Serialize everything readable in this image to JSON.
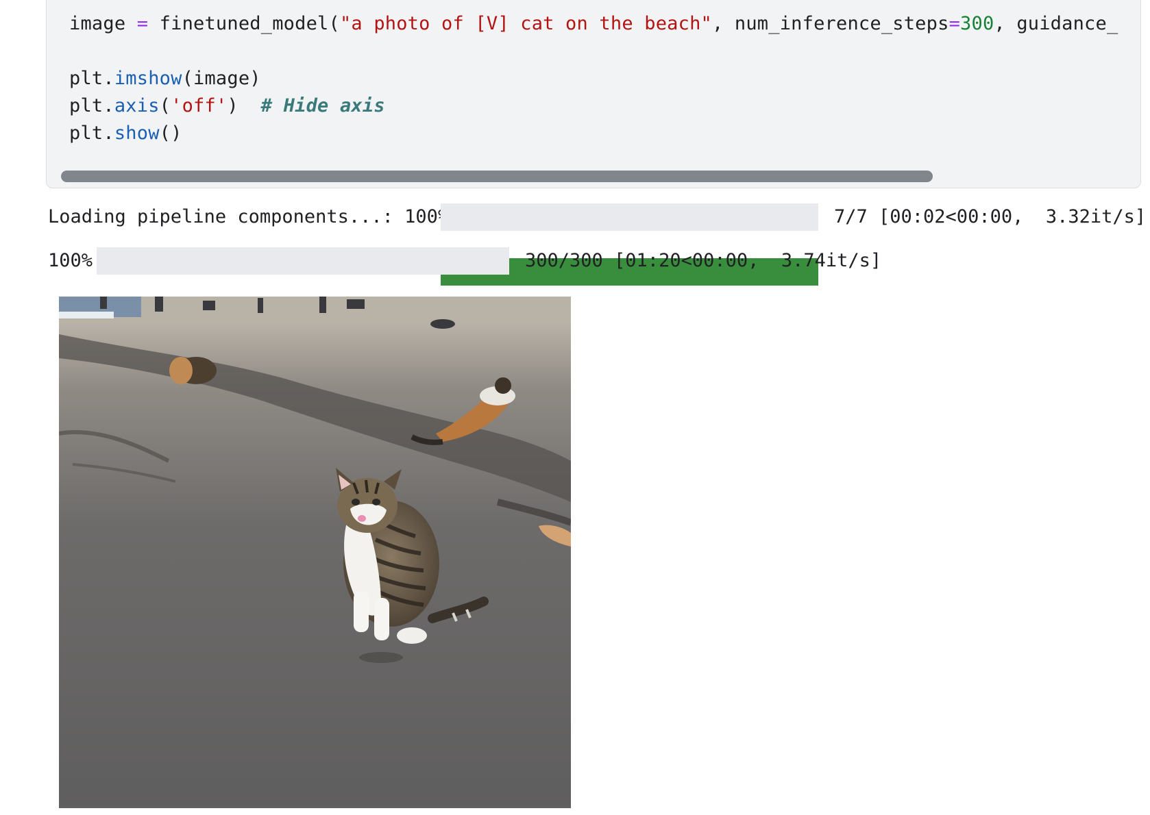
{
  "code_cell": {
    "lines": [
      [
        {
          "t": "image ",
          "k": "default"
        },
        {
          "t": "=",
          "k": "op"
        },
        {
          "t": " finetuned_model(",
          "k": "default"
        },
        {
          "t": "\"a photo of [V] cat on the beach\"",
          "k": "str"
        },
        {
          "t": ", num_inference_steps",
          "k": "default"
        },
        {
          "t": "=",
          "k": "op"
        },
        {
          "t": "300",
          "k": "num"
        },
        {
          "t": ", guidance_",
          "k": "default"
        }
      ],
      [],
      [
        {
          "t": "plt.",
          "k": "default"
        },
        {
          "t": "imshow",
          "k": "fn"
        },
        {
          "t": "(image)",
          "k": "default"
        }
      ],
      [
        {
          "t": "plt.",
          "k": "default"
        },
        {
          "t": "axis",
          "k": "fn"
        },
        {
          "t": "(",
          "k": "default"
        },
        {
          "t": "'off'",
          "k": "str"
        },
        {
          "t": ")  ",
          "k": "default"
        },
        {
          "t": "# Hide axis",
          "k": "comment"
        }
      ],
      [
        {
          "t": "plt.",
          "k": "default"
        },
        {
          "t": "show",
          "k": "fn"
        },
        {
          "t": "()",
          "k": "default"
        }
      ]
    ],
    "horizontal_scroll_fraction": 0.81
  },
  "outputs": {
    "progress": [
      {
        "label": "Loading pipeline components...: 100%",
        "fraction": 1.0,
        "stats": "7/7 [00:02<00:00,  3.32it/s]"
      },
      {
        "label": "100%",
        "fraction": 1.0,
        "stats": "300/300 [01:20<00:00,  3.74it/s]"
      }
    ],
    "image": {
      "icon": "generated-cat-on-beach-image"
    }
  },
  "colors": {
    "progress_fill": "#388e3c",
    "code_background": "#f1f3f4",
    "string": "#b31412",
    "number": "#188038",
    "operator": "#9334e6",
    "function": "#1a5fb4",
    "comment": "#3b7a7a"
  }
}
